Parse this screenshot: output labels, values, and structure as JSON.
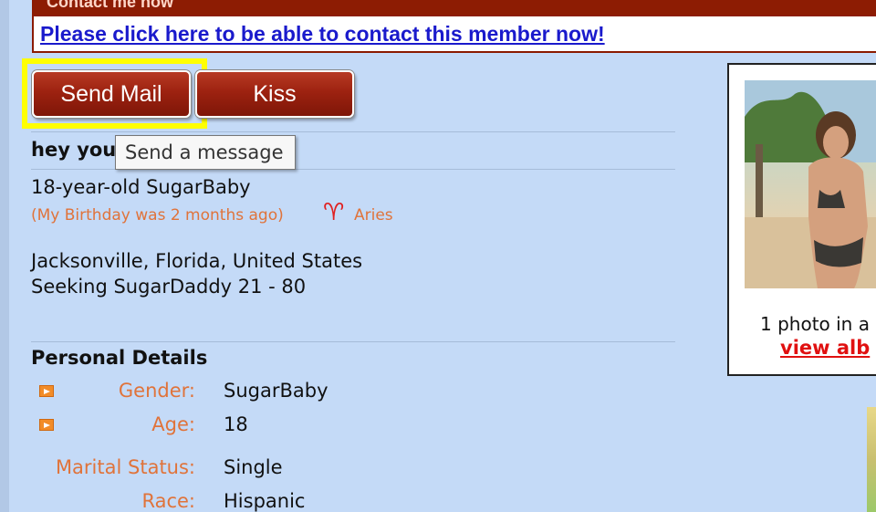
{
  "contact": {
    "heading": "Contact me now",
    "link": "Please click here to be able to contact this member now!"
  },
  "buttons": {
    "send_mail": "Send Mail",
    "kiss": "Kiss"
  },
  "tooltip": "Send a message",
  "profile": {
    "headline": "hey you",
    "age_line": "18-year-old SugarBaby",
    "birthday": "(My Birthday was 2 months ago)",
    "zodiac_icon": "aries-icon",
    "zodiac_glyph": "♈",
    "zodiac": "Aries",
    "location": "Jacksonville, Florida, United States",
    "seeking": "Seeking SugarDaddy 21 - 80"
  },
  "personal_details": {
    "title": "Personal Details",
    "rows": [
      {
        "label": "Gender:",
        "value": "SugarBaby",
        "icon": "arrow-icon"
      },
      {
        "label": "Age:",
        "value": "18",
        "icon": "arrow-icon"
      },
      {
        "label": "Marital Status:",
        "value": "Single"
      },
      {
        "label": "Race:",
        "value": "Hispanic"
      }
    ]
  },
  "photo_album": {
    "caption": "1 photo in a",
    "link": "view alb"
  },
  "colors": {
    "page_bg": "#c4daf7",
    "button_red": "#9d2210",
    "label_orange": "#e0733a",
    "link_blue": "#1a1acc",
    "highlight_yellow": "#ffff00"
  }
}
